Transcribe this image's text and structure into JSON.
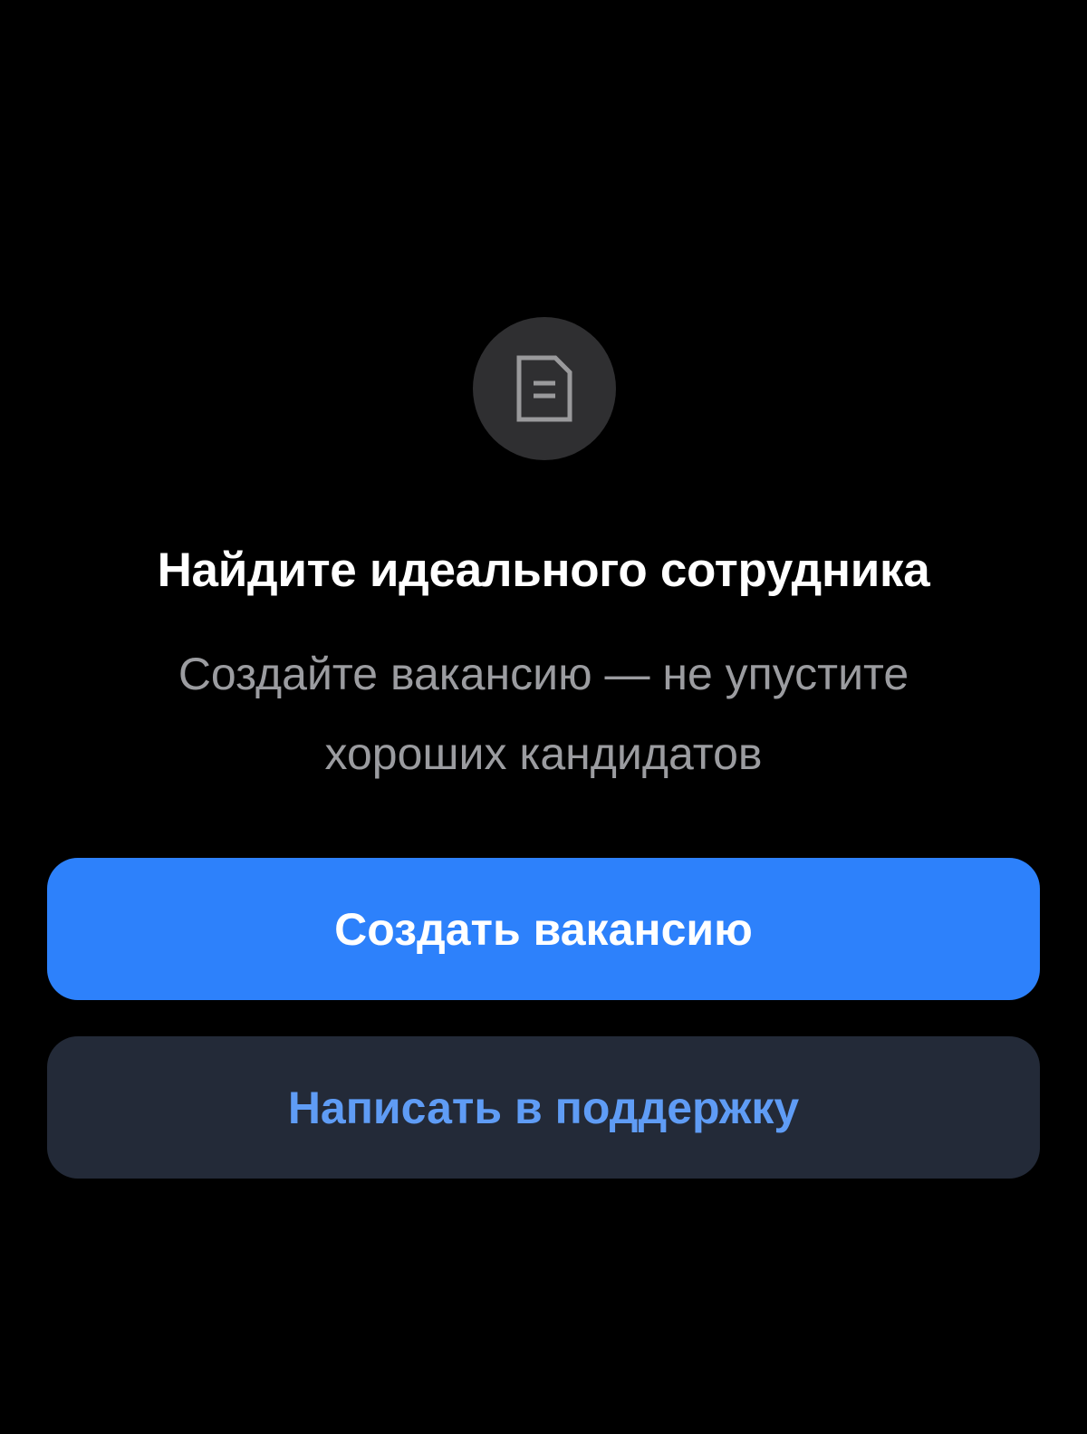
{
  "empty_state": {
    "icon": "document-icon",
    "title": "Найдите идеального сотрудника",
    "subtitle": "Создайте вакансию — не упустите\nхороших кандидатов"
  },
  "actions": {
    "primary_label": "Создать вакансию",
    "secondary_label": "Написать в поддержку"
  },
  "colors": {
    "background": "#000000",
    "icon_circle": "#2f2f31",
    "primary_button": "#2d81fb",
    "secondary_button": "#232a38",
    "secondary_text": "#5f9cf5",
    "subtitle_text": "#9b9ca0"
  }
}
